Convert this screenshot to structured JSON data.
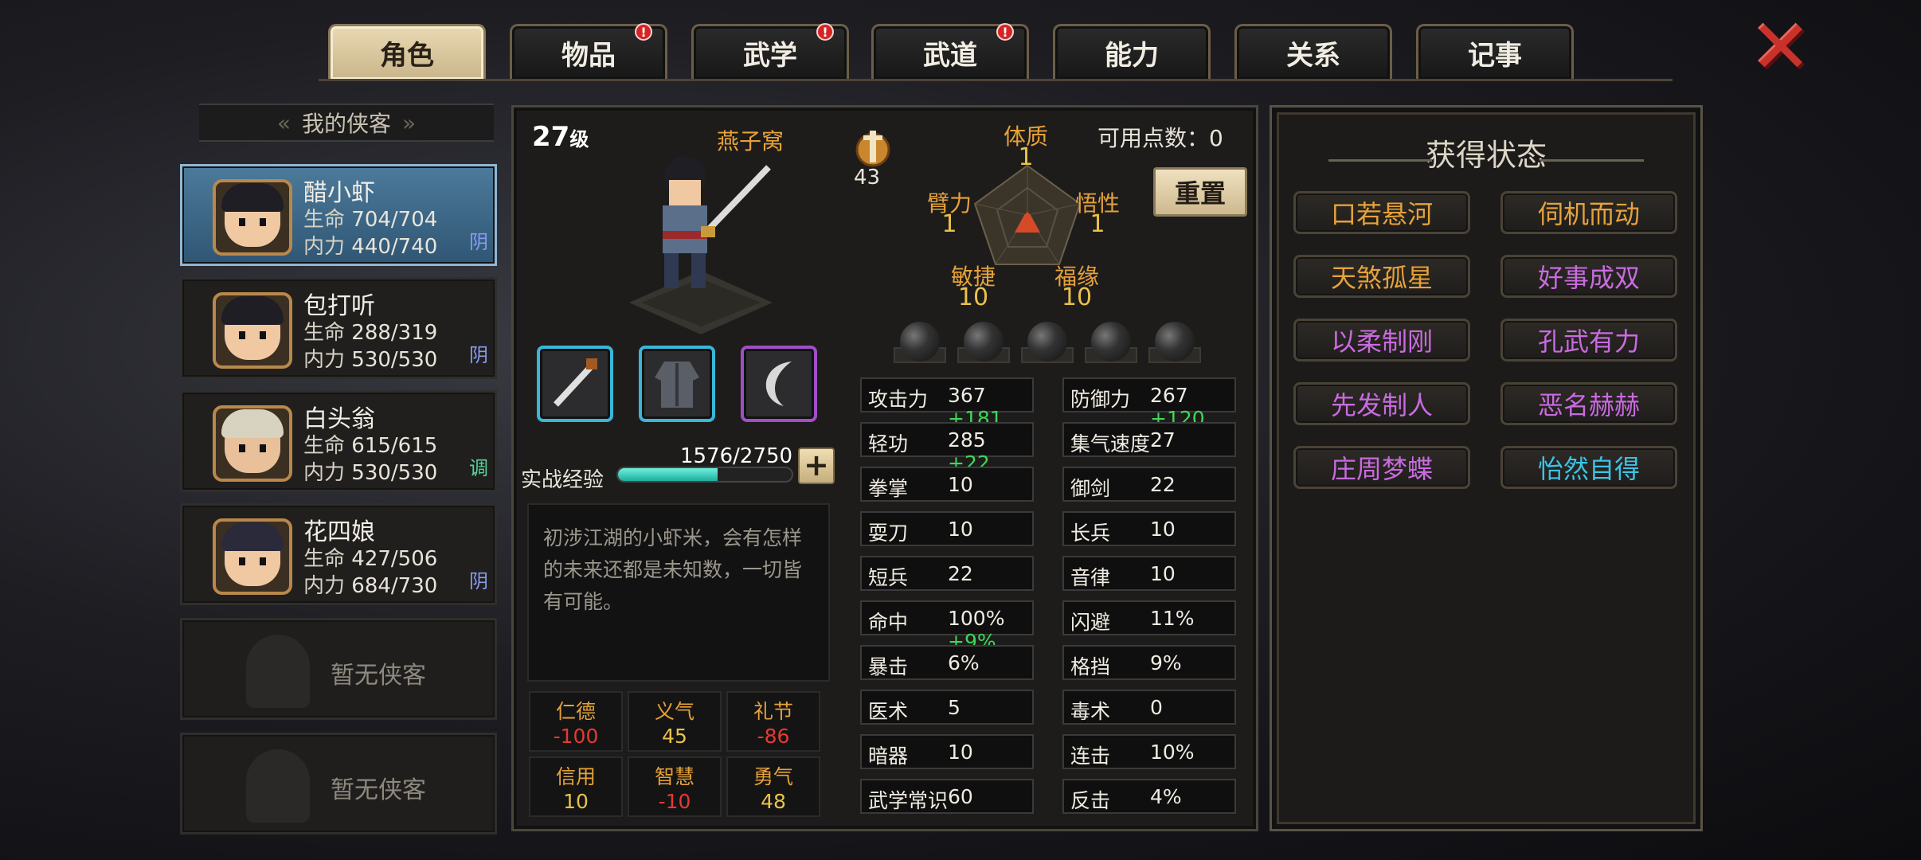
{
  "tabs": [
    {
      "label": "角色",
      "badge": false,
      "active": true
    },
    {
      "label": "物品",
      "badge": true
    },
    {
      "label": "武学",
      "badge": true
    },
    {
      "label": "武道",
      "badge": true
    },
    {
      "label": "能力",
      "badge": false
    },
    {
      "label": "关系",
      "badge": false
    },
    {
      "label": "记事",
      "badge": false
    }
  ],
  "badge_mark": "!",
  "close_glyph": "✕",
  "roster": {
    "title": "我的侠客",
    "hp_label": "生命",
    "mp_label": "内力",
    "members": [
      {
        "name": "醋小虾",
        "hp": "704/704",
        "mp": "440/740",
        "tag": "阴",
        "tag_color": "#8a9cf0"
      },
      {
        "name": "包打听",
        "hp": "288/319",
        "mp": "530/530",
        "tag": "阴",
        "tag_color": "#8a9cf0"
      },
      {
        "name": "白头翁",
        "hp": "615/615",
        "mp": "530/530",
        "tag": "调",
        "tag_color": "#56d49a"
      },
      {
        "name": "花四娘",
        "hp": "427/506",
        "mp": "684/730",
        "tag": "阴",
        "tag_color": "#8a9cf0"
      }
    ],
    "empty_label": "暂无侠客"
  },
  "hero": {
    "level": "27",
    "level_suffix": "级",
    "sect": "燕子窝",
    "medal_value": "43",
    "points_label": "可用点数：0",
    "reset_label": "重置",
    "attributes": {
      "tizhi": {
        "label": "体质",
        "value": "1"
      },
      "bili": {
        "label": "臂力",
        "value": "1"
      },
      "wuxing": {
        "label": "悟性",
        "value": "1"
      },
      "minjie": {
        "label": "敏捷",
        "value": "10"
      },
      "fuyuan": {
        "label": "福缘",
        "value": "10"
      }
    },
    "exp_label": "实战经验",
    "exp_text": "1576/2750",
    "exp_fraction": 0.573,
    "description": "初涉江湖的小虾米，会有怎样的未来还都是未知数，一切皆有可能。",
    "virtues": [
      {
        "label": "仁德",
        "value": "-100",
        "color": "#e53a34"
      },
      {
        "label": "义气",
        "value": "45",
        "color": "#e9c24a"
      },
      {
        "label": "礼节",
        "value": "-86",
        "color": "#e53a34"
      },
      {
        "label": "信用",
        "value": "10",
        "color": "#e9c24a"
      },
      {
        "label": "智慧",
        "value": "-10",
        "color": "#e53a34"
      },
      {
        "label": "勇气",
        "value": "48",
        "color": "#e9c24a"
      }
    ],
    "stats_left": [
      {
        "label": "攻击力",
        "value": "367",
        "bonus": "+181"
      },
      {
        "label": "轻功",
        "value": "285",
        "bonus": "+22"
      },
      {
        "label": "拳掌",
        "value": "10",
        "bonus": ""
      },
      {
        "label": "耍刀",
        "value": "10",
        "bonus": ""
      },
      {
        "label": "短兵",
        "value": "22",
        "bonus": ""
      },
      {
        "label": "命中",
        "value": "100%",
        "bonus": "+9%"
      },
      {
        "label": "暴击",
        "value": "6%",
        "bonus": ""
      },
      {
        "label": "医术",
        "value": "5",
        "bonus": ""
      },
      {
        "label": "暗器",
        "value": "10",
        "bonus": ""
      },
      {
        "label": "武学常识",
        "value": "60",
        "bonus": ""
      }
    ],
    "stats_right": [
      {
        "label": "防御力",
        "value": "267",
        "bonus": "+120"
      },
      {
        "label": "集气速度",
        "value": "27",
        "bonus": ""
      },
      {
        "label": "御剑",
        "value": "22",
        "bonus": ""
      },
      {
        "label": "长兵",
        "value": "10",
        "bonus": ""
      },
      {
        "label": "音律",
        "value": "10",
        "bonus": ""
      },
      {
        "label": "闪避",
        "value": "11%",
        "bonus": ""
      },
      {
        "label": "格挡",
        "value": "9%",
        "bonus": ""
      },
      {
        "label": "毒术",
        "value": "0",
        "bonus": ""
      },
      {
        "label": "连击",
        "value": "10%",
        "bonus": ""
      },
      {
        "label": "反击",
        "value": "4%",
        "bonus": ""
      }
    ],
    "equipment_icons": [
      "sword-icon",
      "robe-icon",
      "sickle-icon"
    ]
  },
  "status_panel": {
    "title": "获得状态",
    "states": [
      {
        "label": "口若悬河",
        "color": "#e6a23a"
      },
      {
        "label": "伺机而动",
        "color": "#e6a23a"
      },
      {
        "label": "天煞孤星",
        "color": "#e6a23a"
      },
      {
        "label": "好事成双",
        "color": "#c96be0"
      },
      {
        "label": "以柔制刚",
        "color": "#c96be0"
      },
      {
        "label": "孔武有力",
        "color": "#c96be0"
      },
      {
        "label": "先发制人",
        "color": "#c96be0"
      },
      {
        "label": "恶名赫赫",
        "color": "#c96be0"
      },
      {
        "label": "庄周梦蝶",
        "color": "#c96be0"
      },
      {
        "label": "怡然自得",
        "color": "#3cc4e6"
      }
    ]
  }
}
